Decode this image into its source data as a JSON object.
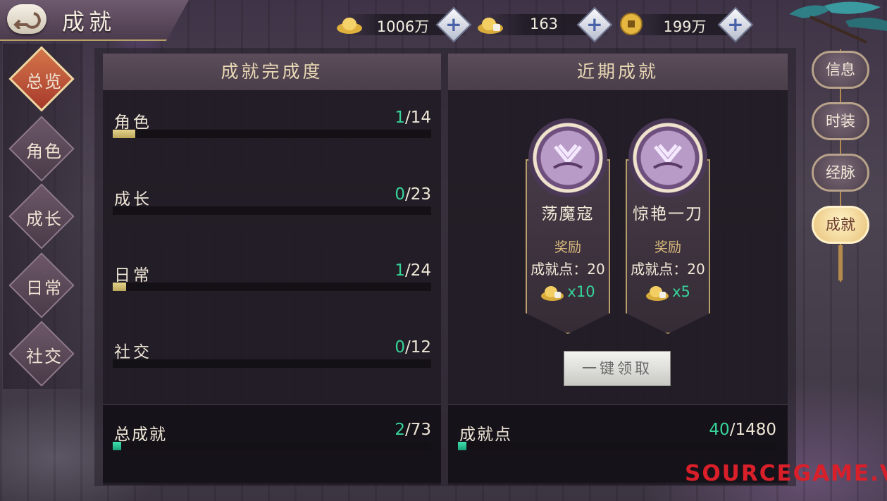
{
  "header": {
    "title": "成就"
  },
  "currencies": [
    {
      "icon": "gold-ingot-icon",
      "value": "1006万"
    },
    {
      "icon": "locked-ingot-icon",
      "value": "163"
    },
    {
      "icon": "copper-coin-icon",
      "value": "199万"
    }
  ],
  "left_nav": [
    {
      "label": "总览",
      "active": true
    },
    {
      "label": "角色",
      "active": false
    },
    {
      "label": "成长",
      "active": false
    },
    {
      "label": "日常",
      "active": false
    },
    {
      "label": "社交",
      "active": false
    }
  ],
  "completion_panel": {
    "title": "成就完成度",
    "categories": [
      {
        "name": "角色",
        "current": "1",
        "total": "/14",
        "progress": 0.0714
      },
      {
        "name": "成长",
        "current": "0",
        "total": "/23",
        "progress": 0
      },
      {
        "name": "日常",
        "current": "1",
        "total": "/24",
        "progress": 0.0417
      },
      {
        "name": "社交",
        "current": "0",
        "total": "/12",
        "progress": 0
      }
    ],
    "total": {
      "name": "总成就",
      "current": "2",
      "total": "/73",
      "progress": 0.0274
    }
  },
  "recent_panel": {
    "title": "近期成就",
    "cards": [
      {
        "name": "荡魔寇",
        "reward_label": "奖励",
        "points_text": "成就点：20",
        "item_icon": "locked-ingot-icon",
        "item_qty": "x10"
      },
      {
        "name": "惊艳一刀",
        "reward_label": "奖励",
        "points_text": "成就点：20",
        "item_icon": "locked-ingot-icon",
        "item_qty": "x5"
      }
    ],
    "claim_button": "一键领取",
    "points": {
      "name": "成就点",
      "current": "40",
      "total": "/1480",
      "progress": 0.027
    }
  },
  "right_tabs": [
    {
      "label": "信息",
      "active": false
    },
    {
      "label": "时装",
      "active": false
    },
    {
      "label": "经脉",
      "active": false
    },
    {
      "label": "成就",
      "active": true
    }
  ],
  "watermark": "SOURCEGAME.VN",
  "colors": {
    "accent_green": "#37d49a",
    "accent_gold": "#d9b97d",
    "active_nav": "#b5432f"
  }
}
